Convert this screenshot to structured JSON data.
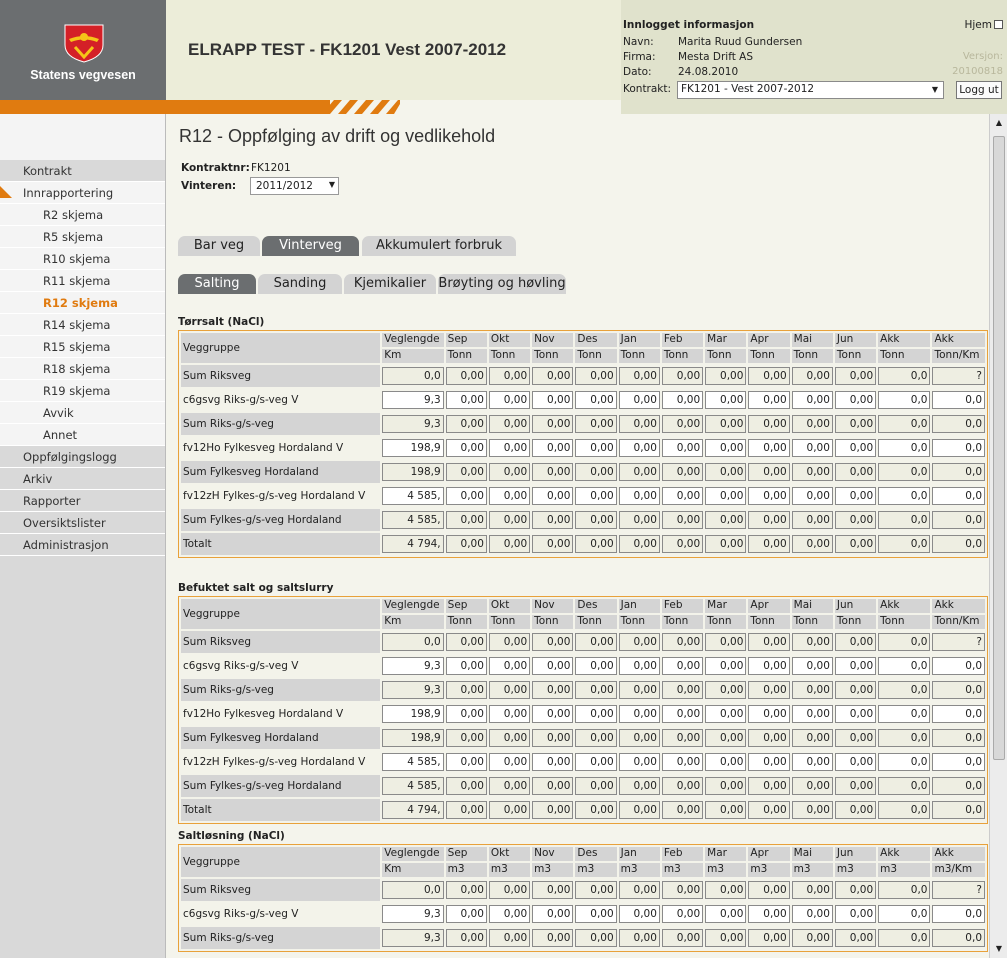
{
  "brand": {
    "name": "Statens vegvesen",
    "shield_color": "#d42027",
    "accent": "#e07b10"
  },
  "app_title": "ELRAPP TEST - FK1201 Vest 2007-2012",
  "info": {
    "heading": "Innlogget informasjon",
    "home_label": "Hjem",
    "name_label": "Navn:",
    "name": "Marita Ruud Gundersen",
    "company_label": "Firma:",
    "company": "Mesta Drift AS",
    "date_label": "Dato:",
    "date": "24.08.2010",
    "contract_label": "Kontrakt:",
    "contract": "FK1201 - Vest 2007-2012",
    "version_label": "Versjon:",
    "version": "20100818",
    "logout_label": "Logg ut"
  },
  "sidebar": [
    {
      "label": "Kontrakt",
      "sub": false
    },
    {
      "label": "Innrapportering",
      "sub": false,
      "open": true
    },
    {
      "label": "R2 skjema",
      "sub": true
    },
    {
      "label": "R5 skjema",
      "sub": true
    },
    {
      "label": "R10 skjema",
      "sub": true
    },
    {
      "label": "R11 skjema",
      "sub": true
    },
    {
      "label": "R12 skjema",
      "sub": true,
      "active": true
    },
    {
      "label": "R14 skjema",
      "sub": true
    },
    {
      "label": "R15 skjema",
      "sub": true
    },
    {
      "label": "R18 skjema",
      "sub": true
    },
    {
      "label": "R19 skjema",
      "sub": true
    },
    {
      "label": "Avvik",
      "sub": true
    },
    {
      "label": "Annet",
      "sub": true
    },
    {
      "label": "Oppfølgingslogg",
      "sub": false
    },
    {
      "label": "Arkiv",
      "sub": false
    },
    {
      "label": "Rapporter",
      "sub": false
    },
    {
      "label": "Oversiktslister",
      "sub": false
    },
    {
      "label": "Administrasjon",
      "sub": false
    }
  ],
  "page": {
    "title": "R12 - Oppfølging av drift og vedlikehold",
    "contract_no_label": "Kontraktnr:",
    "contract_no": "FK1201",
    "winter_label": "Vinteren:",
    "winter": "2011/2012"
  },
  "tabs_top": [
    {
      "label": "Bar veg"
    },
    {
      "label": "Vinterveg",
      "selected": true
    },
    {
      "label": "Akkumulert forbruk"
    }
  ],
  "tabs_sub": [
    {
      "label": "Salting",
      "selected": true
    },
    {
      "label": "Sanding"
    },
    {
      "label": "Kjemikalier"
    },
    {
      "label": "Brøyting og høvling"
    }
  ],
  "sections": [
    {
      "title": "Tørrsalt (NaCl)",
      "headers": [
        "Veggruppe",
        "Veglengde",
        "Sep",
        "Okt",
        "Nov",
        "Des",
        "Jan",
        "Feb",
        "Mar",
        "Apr",
        "Mai",
        "Jun",
        "Akk",
        "Akk"
      ],
      "units": [
        "Km",
        "Tonn",
        "Tonn",
        "Tonn",
        "Tonn",
        "Tonn",
        "Tonn",
        "Tonn",
        "Tonn",
        "Tonn",
        "Tonn",
        "Tonn",
        "Tonn/Km"
      ],
      "rows": [
        {
          "label": "Sum Riksveg",
          "len": "0,0",
          "akk": "0,0",
          "akkkm": "?",
          "sum": true
        },
        {
          "label": "c6gsvg Riks-g/s-veg V",
          "len": "9,3",
          "akk": "0,0",
          "akkkm": "0,0",
          "sum": false
        },
        {
          "label": "Sum Riks-g/s-veg",
          "len": "9,3",
          "akk": "0,0",
          "akkkm": "0,0",
          "sum": true
        },
        {
          "label": "fv12Ho Fylkesveg Hordaland V",
          "len": "198,9",
          "akk": "0,0",
          "akkkm": "0,0",
          "sum": false
        },
        {
          "label": "Sum Fylkesveg Hordaland",
          "len": "198,9",
          "akk": "0,0",
          "akkkm": "0,0",
          "sum": true
        },
        {
          "label": "fv12zH Fylkes-g/s-veg Hordaland V",
          "len": "4 585,",
          "akk": "0,0",
          "akkkm": "0,0",
          "sum": false
        },
        {
          "label": "Sum Fylkes-g/s-veg Hordaland",
          "len": "4 585,",
          "akk": "0,0",
          "akkkm": "0,0",
          "sum": true
        },
        {
          "label": "Totalt",
          "len": "4 794,",
          "akk": "0,0",
          "akkkm": "0,0",
          "sum": true
        }
      ]
    },
    {
      "title": "Befuktet salt og saltslurry",
      "headers": [
        "Veggruppe",
        "Veglengde",
        "Sep",
        "Okt",
        "Nov",
        "Des",
        "Jan",
        "Feb",
        "Mar",
        "Apr",
        "Mai",
        "Jun",
        "Akk",
        "Akk"
      ],
      "units": [
        "Km",
        "Tonn",
        "Tonn",
        "Tonn",
        "Tonn",
        "Tonn",
        "Tonn",
        "Tonn",
        "Tonn",
        "Tonn",
        "Tonn",
        "Tonn",
        "Tonn/Km"
      ],
      "rows": [
        {
          "label": "Sum Riksveg",
          "len": "0,0",
          "akk": "0,0",
          "akkkm": "?",
          "sum": true
        },
        {
          "label": "c6gsvg Riks-g/s-veg V",
          "len": "9,3",
          "akk": "0,0",
          "akkkm": "0,0",
          "sum": false
        },
        {
          "label": "Sum Riks-g/s-veg",
          "len": "9,3",
          "akk": "0,0",
          "akkkm": "0,0",
          "sum": true
        },
        {
          "label": "fv12Ho Fylkesveg Hordaland V",
          "len": "198,9",
          "akk": "0,0",
          "akkkm": "0,0",
          "sum": false
        },
        {
          "label": "Sum Fylkesveg Hordaland",
          "len": "198,9",
          "akk": "0,0",
          "akkkm": "0,0",
          "sum": true
        },
        {
          "label": "fv12zH Fylkes-g/s-veg Hordaland V",
          "len": "4 585,",
          "akk": "0,0",
          "akkkm": "0,0",
          "sum": false
        },
        {
          "label": "Sum Fylkes-g/s-veg Hordaland",
          "len": "4 585,",
          "akk": "0,0",
          "akkkm": "0,0",
          "sum": true
        },
        {
          "label": "Totalt",
          "len": "4 794,",
          "akk": "0,0",
          "akkkm": "0,0",
          "sum": true
        }
      ]
    },
    {
      "title": "Saltløsning (NaCl)",
      "headers": [
        "Veggruppe",
        "Veglengde",
        "Sep",
        "Okt",
        "Nov",
        "Des",
        "Jan",
        "Feb",
        "Mar",
        "Apr",
        "Mai",
        "Jun",
        "Akk",
        "Akk"
      ],
      "units": [
        "Km",
        "m3",
        "m3",
        "m3",
        "m3",
        "m3",
        "m3",
        "m3",
        "m3",
        "m3",
        "m3",
        "m3",
        "m3/Km"
      ],
      "rows": [
        {
          "label": "Sum Riksveg",
          "len": "0,0",
          "akk": "0,0",
          "akkkm": "?",
          "sum": true
        },
        {
          "label": "c6gsvg Riks-g/s-veg V",
          "len": "9,3",
          "akk": "0,0",
          "akkkm": "0,0",
          "sum": false
        },
        {
          "label": "Sum Riks-g/s-veg",
          "len": "9,3",
          "akk": "0,0",
          "akkkm": "0,0",
          "sum": true
        }
      ]
    }
  ],
  "cell_value": "0,00"
}
